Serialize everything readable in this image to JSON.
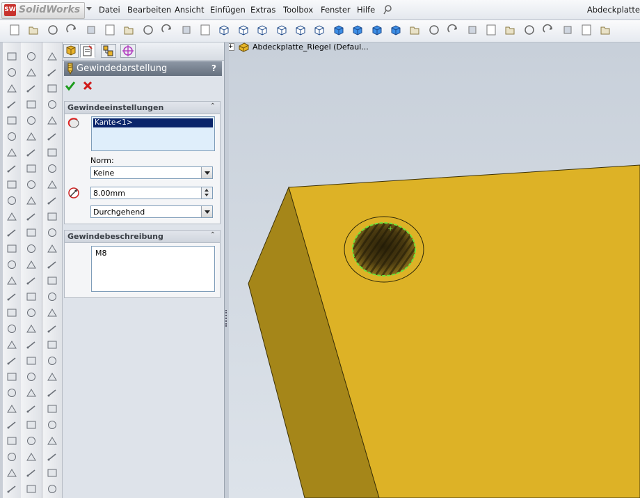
{
  "app": {
    "logo_text": "SolidWorks",
    "window_title": "Abdeckplatte"
  },
  "menu": [
    "Datei",
    "Bearbeiten",
    "Ansicht",
    "Einfügen",
    "Extras",
    "Toolbox",
    "Fenster",
    "Hilfe"
  ],
  "toolbar_icons": [
    "new-icon",
    "open-icon",
    "save-icon",
    "print-icon",
    "preview-icon",
    "copy-icon",
    "paste-icon",
    "undo-icon",
    "redo-icon",
    "rebuild-icon",
    "select-icon",
    "view-iso-icon",
    "view-front-icon",
    "view-back-icon",
    "view-left-icon",
    "view-right-icon",
    "view-top-icon",
    "view-bottom-icon",
    "view-normal-icon",
    "view-shaded-icon",
    "view-shaded-edges-icon",
    "zoom-icon",
    "section-icon",
    "rotate-icon",
    "pan-icon",
    "measure-icon",
    "appearance-icon",
    "lights-icon",
    "curve-icon",
    "triad-icon",
    "sketch-icon",
    "options-icon"
  ],
  "property_manager": {
    "title": "Gewindedarstellung",
    "help": "?",
    "tabs": [
      "feature-manager-tab",
      "property-manager-tab",
      "configuration-manager-tab",
      "dim-expert-tab"
    ],
    "ok_icon": "ok-checkmark-icon",
    "cancel_icon": "cancel-x-icon",
    "settings_group": {
      "title": "Gewindeeinstellungen",
      "edge_selection": "Kante<1>",
      "norm_label": "Norm:",
      "norm_value": "Keine",
      "diameter_value": "8.00mm",
      "end_condition": "Durchgehend"
    },
    "description_group": {
      "title": "Gewindebeschreibung",
      "text": "M8"
    }
  },
  "feature_tree": {
    "expand": "+",
    "root_label": "Abdeckplatte_Riegel  (Defaul..."
  },
  "colors": {
    "part_top": "#ddb226",
    "part_side": "#a58619",
    "selection_edge": "#6fe23a"
  }
}
